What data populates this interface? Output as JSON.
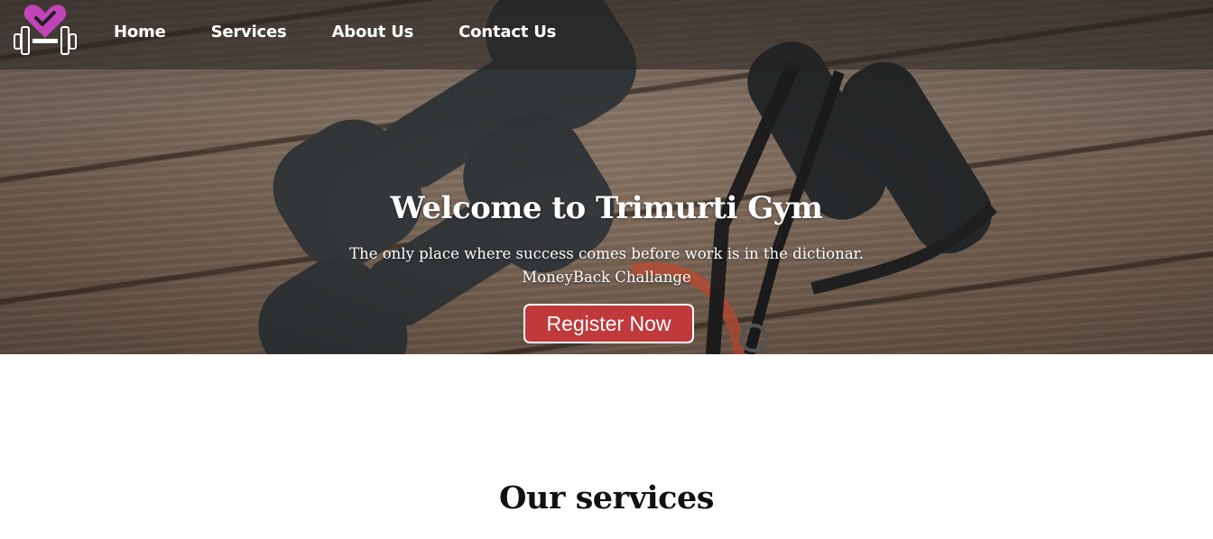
{
  "nav": {
    "links": [
      {
        "label": "Home"
      },
      {
        "label": "Services"
      },
      {
        "label": "About Us"
      },
      {
        "label": "Contact Us"
      }
    ],
    "logo_icon": "heart-dumbbell-icon"
  },
  "hero": {
    "title": "Welcome to Trimurti Gym",
    "subtitle_line1": "The only place where success comes before work is in the dictionar.",
    "subtitle_line2": "MoneyBack Challange",
    "cta_label": "Register Now"
  },
  "services": {
    "heading": "Our services"
  },
  "colors": {
    "cta_background": "#c0393b",
    "logo_heart": "#c244b8",
    "navbar_overlay": "rgba(40,36,34,0.55)"
  }
}
